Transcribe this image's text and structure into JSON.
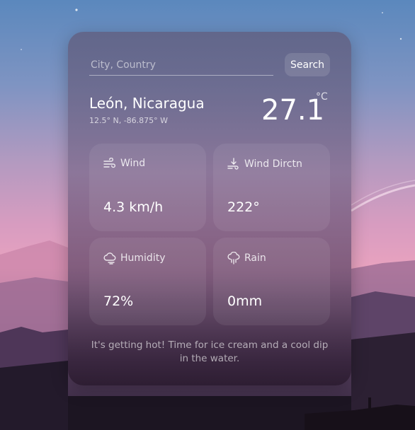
{
  "search": {
    "placeholder": "City, Country",
    "value": "",
    "button_label": "Search"
  },
  "location": {
    "name": "León, Nicaragua",
    "coords": "12.5° N, -86.875° W"
  },
  "temperature": {
    "value": "27.1",
    "unit": "°C"
  },
  "tiles": [
    {
      "label": "Wind",
      "value": "4.3 km/h",
      "icon": "wind-icon"
    },
    {
      "label": "Wind Dirctn",
      "value": "222°",
      "icon": "wind-direction-icon"
    },
    {
      "label": "Humidity",
      "value": "72%",
      "icon": "humidity-icon"
    },
    {
      "label": "Rain",
      "value": "0mm",
      "icon": "rain-icon"
    }
  ],
  "message": "It's getting hot! Time for ice cream and a cool dip in the water."
}
